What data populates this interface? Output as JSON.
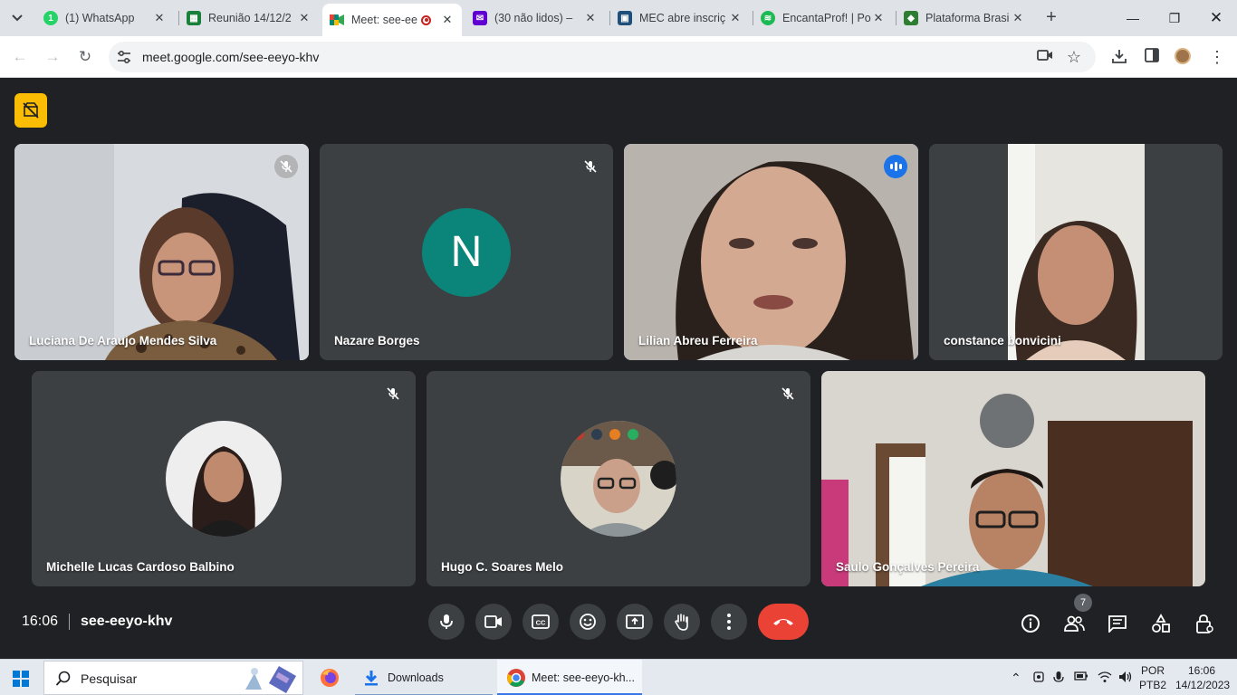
{
  "browser": {
    "tabs": [
      {
        "title": "(1) WhatsApp",
        "favicon": "whatsapp-icon",
        "color": "#25d366"
      },
      {
        "title": "Reunião 14/12/2",
        "favicon": "sheets-icon",
        "color": "#188038"
      },
      {
        "title": "Meet: see-ee",
        "favicon": "meet-icon",
        "color": "#00897b",
        "active": true
      },
      {
        "title": "(30 não lidos) – ",
        "favicon": "yahoo-mail-icon",
        "color": "#6001d2"
      },
      {
        "title": "MEC abre inscriç",
        "favicon": "news-icon",
        "color": "#1f4e79"
      },
      {
        "title": "EncantaProf! | Po",
        "favicon": "spotify-icon",
        "color": "#1db954"
      },
      {
        "title": "Plataforma Brasi",
        "favicon": "platform-icon",
        "color": "#2e7d32"
      }
    ],
    "url": "meet.google.com/see-eeyo-khv"
  },
  "meet": {
    "participants": [
      {
        "name": "Luciana De Araujo Mendes Silva",
        "muted": true
      },
      {
        "name": "Nazare Borges",
        "muted": true,
        "initial": "N",
        "avatar_color": "#0b8579"
      },
      {
        "name": "Lilian Abreu Ferreira",
        "speaking": true
      },
      {
        "name": "constance bonvicini"
      },
      {
        "name": "Michelle Lucas Cardoso Balbino",
        "muted": true
      },
      {
        "name": "Hugo C. Soares Melo",
        "muted": true
      },
      {
        "name": "Saulo Gonçalves Pereira"
      }
    ],
    "time": "16:06",
    "meeting_code": "see-eeyo-khv",
    "people_count": "7",
    "accent_end_call": "#ea4335"
  },
  "taskbar": {
    "search_placeholder": "Pesquisar",
    "apps": [
      {
        "label": "Downloads"
      },
      {
        "label": "Meet: see-eeyo-kh..."
      }
    ],
    "lang_1": "POR",
    "lang_2": "PTB2",
    "time": "16:06",
    "date": "14/12/2023"
  }
}
